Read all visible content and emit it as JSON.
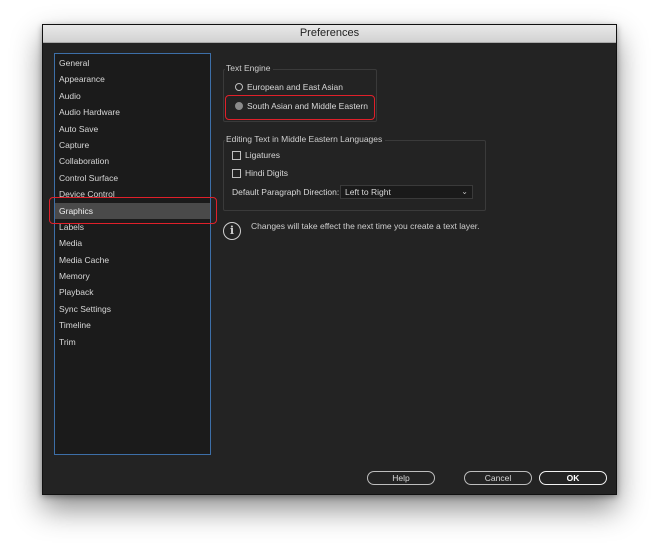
{
  "window": {
    "title": "Preferences"
  },
  "sidebar": {
    "items": [
      {
        "label": "General"
      },
      {
        "label": "Appearance"
      },
      {
        "label": "Audio"
      },
      {
        "label": "Audio Hardware"
      },
      {
        "label": "Auto Save"
      },
      {
        "label": "Capture"
      },
      {
        "label": "Collaboration"
      },
      {
        "label": "Control Surface"
      },
      {
        "label": "Device Control"
      },
      {
        "label": "Graphics"
      },
      {
        "label": "Labels"
      },
      {
        "label": "Media"
      },
      {
        "label": "Media Cache"
      },
      {
        "label": "Memory"
      },
      {
        "label": "Playback"
      },
      {
        "label": "Sync Settings"
      },
      {
        "label": "Timeline"
      },
      {
        "label": "Trim"
      }
    ],
    "selected": "Graphics"
  },
  "text_engine": {
    "label": "Text Engine",
    "options": [
      {
        "label": "European and East Asian",
        "checked": false
      },
      {
        "label": "South Asian and Middle Eastern",
        "checked": true
      }
    ]
  },
  "middle_eastern": {
    "label": "Editing Text in Middle Eastern Languages",
    "ligatures_label": "Ligatures",
    "ligatures_checked": false,
    "hindi_digits_label": "Hindi Digits",
    "hindi_digits_checked": false,
    "direction_label": "Default Paragraph Direction:",
    "direction_value": "Left to Right"
  },
  "info": {
    "text": "Changes will take effect the next time you create a text layer."
  },
  "buttons": {
    "help": "Help",
    "cancel": "Cancel",
    "ok": "OK"
  },
  "colors": {
    "highlight": "#e0202a",
    "sidebar_border": "#3d6fa8",
    "window_bg": "#232323"
  }
}
